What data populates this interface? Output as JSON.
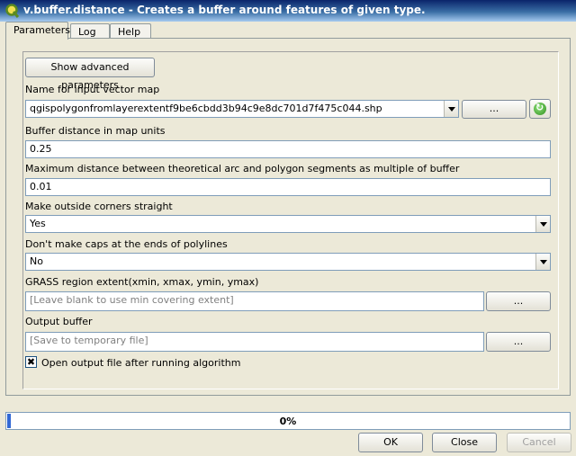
{
  "window": {
    "title": "v.buffer.distance - Creates a buffer around features of given type."
  },
  "tabs": [
    {
      "label": "Parameters",
      "active": true
    },
    {
      "label": "Log",
      "active": false
    },
    {
      "label": "Help",
      "active": false
    }
  ],
  "params": {
    "advanced_button": "Show advanced parameters",
    "input_label": "Name for input vector map",
    "input_value": "qgispolygonfromlayerextentf9be6cbdd3b94c9e8dc701d7f475c044.shp",
    "browse_label": "...",
    "distance_label": "Buffer distance in map units",
    "distance_value": "0.25",
    "tolerance_label": "Maximum distance between theoretical arc and polygon segments as multiple of buffer",
    "tolerance_value": "0.01",
    "corners_label": "Make outside corners straight",
    "corners_value": "Yes",
    "caps_label": "Don't make caps at the ends of polylines",
    "caps_value": "No",
    "region_label": "GRASS region extent(xmin, xmax, ymin, ymax)",
    "region_placeholder": "[Leave blank to use min covering extent]",
    "region_browse": "...",
    "output_label": "Output buffer",
    "output_placeholder": "[Save to temporary file]",
    "output_browse": "...",
    "open_output_label": "Open output file after running algorithm",
    "open_output_checked": true,
    "check_mark": "✖"
  },
  "progress": {
    "value": 0,
    "text": "0%"
  },
  "buttons": {
    "ok": "OK",
    "close": "Close",
    "cancel": "Cancel"
  },
  "icons": {
    "window": "qgis-icon",
    "refresh": "refresh-icon"
  }
}
